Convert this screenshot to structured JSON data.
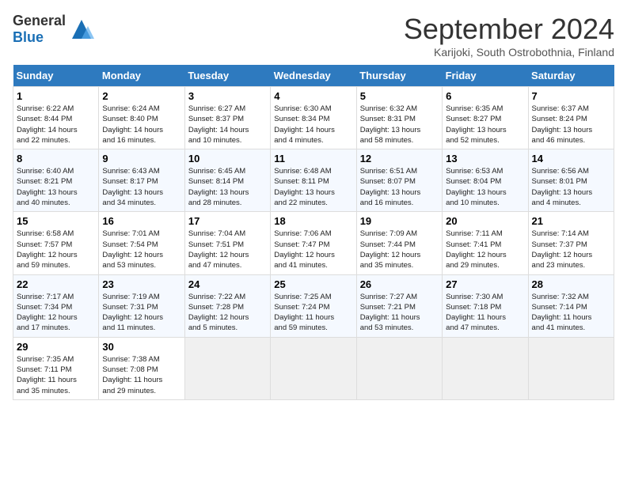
{
  "header": {
    "logo_general": "General",
    "logo_blue": "Blue",
    "month_title": "September 2024",
    "subtitle": "Karijoki, South Ostrobothnia, Finland"
  },
  "days_of_week": [
    "Sunday",
    "Monday",
    "Tuesday",
    "Wednesday",
    "Thursday",
    "Friday",
    "Saturday"
  ],
  "weeks": [
    [
      {
        "day": "1",
        "lines": [
          "Sunrise: 6:22 AM",
          "Sunset: 8:44 PM",
          "Daylight: 14 hours",
          "and 22 minutes."
        ]
      },
      {
        "day": "2",
        "lines": [
          "Sunrise: 6:24 AM",
          "Sunset: 8:40 PM",
          "Daylight: 14 hours",
          "and 16 minutes."
        ]
      },
      {
        "day": "3",
        "lines": [
          "Sunrise: 6:27 AM",
          "Sunset: 8:37 PM",
          "Daylight: 14 hours",
          "and 10 minutes."
        ]
      },
      {
        "day": "4",
        "lines": [
          "Sunrise: 6:30 AM",
          "Sunset: 8:34 PM",
          "Daylight: 14 hours",
          "and 4 minutes."
        ]
      },
      {
        "day": "5",
        "lines": [
          "Sunrise: 6:32 AM",
          "Sunset: 8:31 PM",
          "Daylight: 13 hours",
          "and 58 minutes."
        ]
      },
      {
        "day": "6",
        "lines": [
          "Sunrise: 6:35 AM",
          "Sunset: 8:27 PM",
          "Daylight: 13 hours",
          "and 52 minutes."
        ]
      },
      {
        "day": "7",
        "lines": [
          "Sunrise: 6:37 AM",
          "Sunset: 8:24 PM",
          "Daylight: 13 hours",
          "and 46 minutes."
        ]
      }
    ],
    [
      {
        "day": "8",
        "lines": [
          "Sunrise: 6:40 AM",
          "Sunset: 8:21 PM",
          "Daylight: 13 hours",
          "and 40 minutes."
        ]
      },
      {
        "day": "9",
        "lines": [
          "Sunrise: 6:43 AM",
          "Sunset: 8:17 PM",
          "Daylight: 13 hours",
          "and 34 minutes."
        ]
      },
      {
        "day": "10",
        "lines": [
          "Sunrise: 6:45 AM",
          "Sunset: 8:14 PM",
          "Daylight: 13 hours",
          "and 28 minutes."
        ]
      },
      {
        "day": "11",
        "lines": [
          "Sunrise: 6:48 AM",
          "Sunset: 8:11 PM",
          "Daylight: 13 hours",
          "and 22 minutes."
        ]
      },
      {
        "day": "12",
        "lines": [
          "Sunrise: 6:51 AM",
          "Sunset: 8:07 PM",
          "Daylight: 13 hours",
          "and 16 minutes."
        ]
      },
      {
        "day": "13",
        "lines": [
          "Sunrise: 6:53 AM",
          "Sunset: 8:04 PM",
          "Daylight: 13 hours",
          "and 10 minutes."
        ]
      },
      {
        "day": "14",
        "lines": [
          "Sunrise: 6:56 AM",
          "Sunset: 8:01 PM",
          "Daylight: 13 hours",
          "and 4 minutes."
        ]
      }
    ],
    [
      {
        "day": "15",
        "lines": [
          "Sunrise: 6:58 AM",
          "Sunset: 7:57 PM",
          "Daylight: 12 hours",
          "and 59 minutes."
        ]
      },
      {
        "day": "16",
        "lines": [
          "Sunrise: 7:01 AM",
          "Sunset: 7:54 PM",
          "Daylight: 12 hours",
          "and 53 minutes."
        ]
      },
      {
        "day": "17",
        "lines": [
          "Sunrise: 7:04 AM",
          "Sunset: 7:51 PM",
          "Daylight: 12 hours",
          "and 47 minutes."
        ]
      },
      {
        "day": "18",
        "lines": [
          "Sunrise: 7:06 AM",
          "Sunset: 7:47 PM",
          "Daylight: 12 hours",
          "and 41 minutes."
        ]
      },
      {
        "day": "19",
        "lines": [
          "Sunrise: 7:09 AM",
          "Sunset: 7:44 PM",
          "Daylight: 12 hours",
          "and 35 minutes."
        ]
      },
      {
        "day": "20",
        "lines": [
          "Sunrise: 7:11 AM",
          "Sunset: 7:41 PM",
          "Daylight: 12 hours",
          "and 29 minutes."
        ]
      },
      {
        "day": "21",
        "lines": [
          "Sunrise: 7:14 AM",
          "Sunset: 7:37 PM",
          "Daylight: 12 hours",
          "and 23 minutes."
        ]
      }
    ],
    [
      {
        "day": "22",
        "lines": [
          "Sunrise: 7:17 AM",
          "Sunset: 7:34 PM",
          "Daylight: 12 hours",
          "and 17 minutes."
        ]
      },
      {
        "day": "23",
        "lines": [
          "Sunrise: 7:19 AM",
          "Sunset: 7:31 PM",
          "Daylight: 12 hours",
          "and 11 minutes."
        ]
      },
      {
        "day": "24",
        "lines": [
          "Sunrise: 7:22 AM",
          "Sunset: 7:28 PM",
          "Daylight: 12 hours",
          "and 5 minutes."
        ]
      },
      {
        "day": "25",
        "lines": [
          "Sunrise: 7:25 AM",
          "Sunset: 7:24 PM",
          "Daylight: 11 hours",
          "and 59 minutes."
        ]
      },
      {
        "day": "26",
        "lines": [
          "Sunrise: 7:27 AM",
          "Sunset: 7:21 PM",
          "Daylight: 11 hours",
          "and 53 minutes."
        ]
      },
      {
        "day": "27",
        "lines": [
          "Sunrise: 7:30 AM",
          "Sunset: 7:18 PM",
          "Daylight: 11 hours",
          "and 47 minutes."
        ]
      },
      {
        "day": "28",
        "lines": [
          "Sunrise: 7:32 AM",
          "Sunset: 7:14 PM",
          "Daylight: 11 hours",
          "and 41 minutes."
        ]
      }
    ],
    [
      {
        "day": "29",
        "lines": [
          "Sunrise: 7:35 AM",
          "Sunset: 7:11 PM",
          "Daylight: 11 hours",
          "and 35 minutes."
        ]
      },
      {
        "day": "30",
        "lines": [
          "Sunrise: 7:38 AM",
          "Sunset: 7:08 PM",
          "Daylight: 11 hours",
          "and 29 minutes."
        ]
      },
      null,
      null,
      null,
      null,
      null
    ]
  ]
}
